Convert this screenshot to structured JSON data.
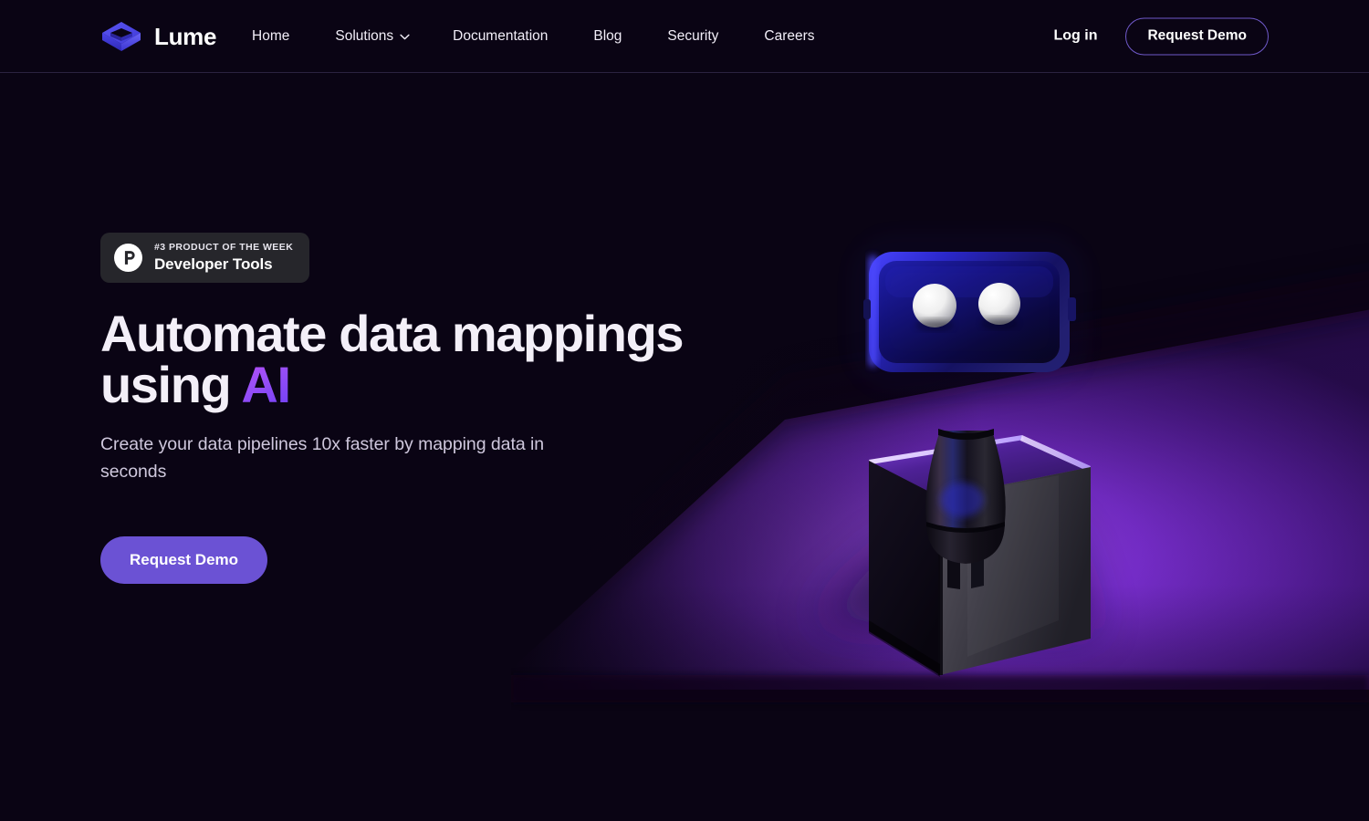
{
  "brand": {
    "name": "Lume",
    "logo_icon": "cube-logo-icon"
  },
  "nav": {
    "items": [
      {
        "label": "Home",
        "has_dropdown": false
      },
      {
        "label": "Solutions",
        "has_dropdown": true
      },
      {
        "label": "Documentation",
        "has_dropdown": false
      },
      {
        "label": "Blog",
        "has_dropdown": false
      },
      {
        "label": "Security",
        "has_dropdown": false
      },
      {
        "label": "Careers",
        "has_dropdown": false
      }
    ]
  },
  "header_actions": {
    "login_label": "Log in",
    "demo_label": "Request Demo"
  },
  "badge": {
    "icon": "product-hunt-icon",
    "kicker": "#3 PRODUCT OF THE WEEK",
    "title": "Developer Tools"
  },
  "hero": {
    "headline_line1": "Automate data mappings",
    "headline_line2_prefix": "using ",
    "headline_accent": "AI",
    "subhead": "Create your data pipelines 10x faster by mapping data in seconds",
    "cta_label": "Request Demo"
  },
  "art": {
    "description": "3D robot with rounded rectangular head and two white eyes standing on a dark cube pedestal lit by purple light"
  },
  "colors": {
    "page_background": "#0a0414",
    "header_border": "#2b2340",
    "brand_blue": "#4a46e8",
    "accent_purple": "#6b52d4",
    "outline_purple": "#6f59c9",
    "badge_background": "#26262b",
    "floor_purple": "#7b2fd6",
    "heading_text": "#f3eff8",
    "body_text": "#cfc8dd"
  }
}
